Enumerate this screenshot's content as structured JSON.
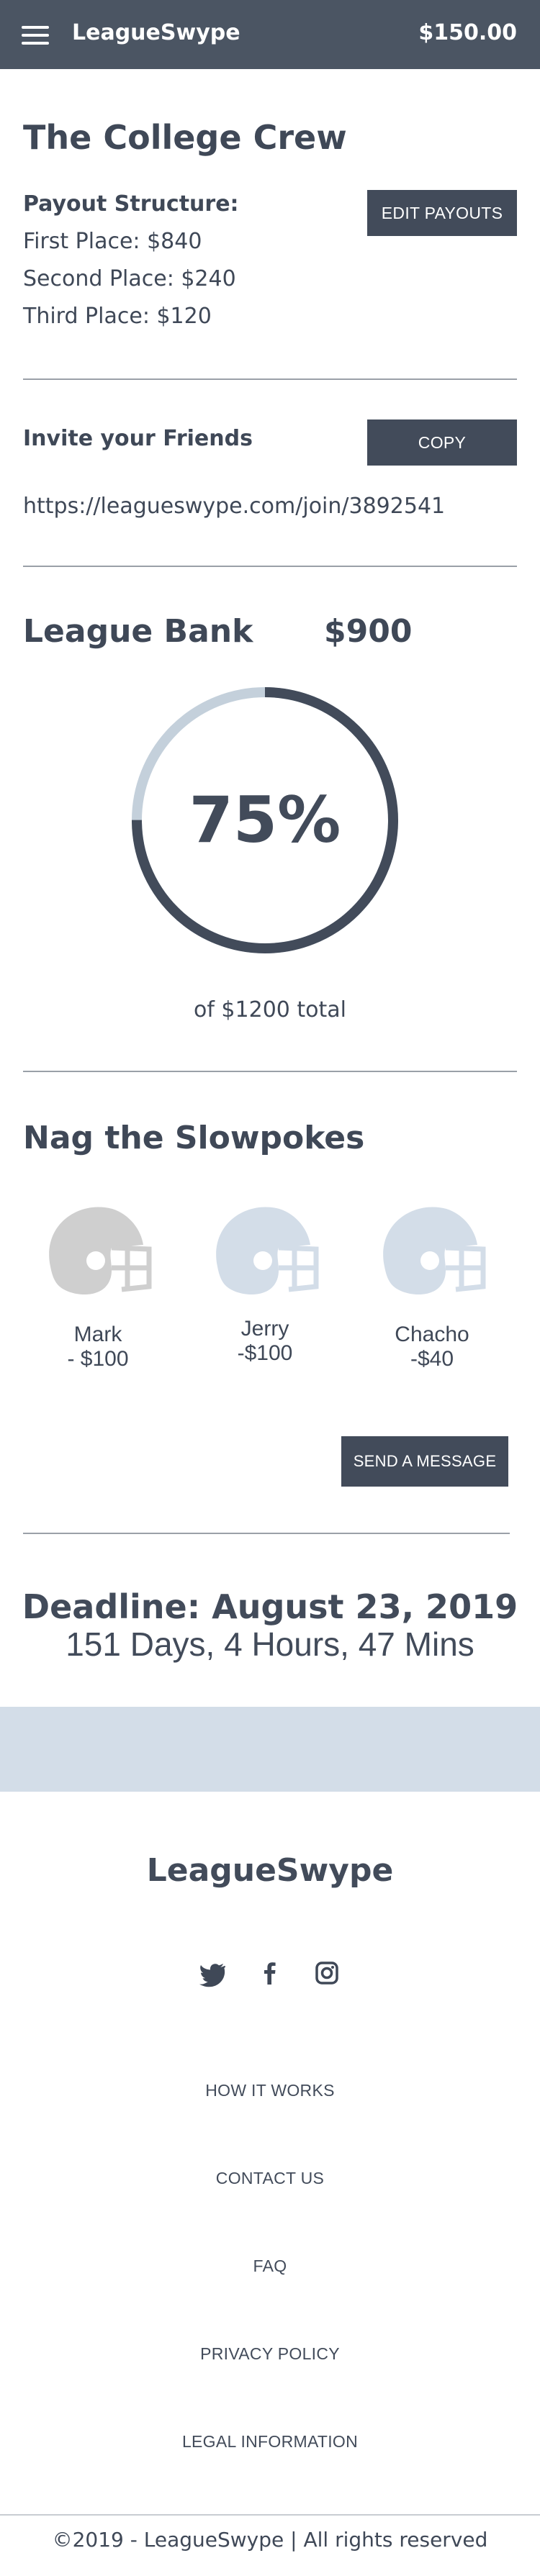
{
  "header": {
    "brand": "LeagueSwype",
    "balance": "$150.00"
  },
  "league": {
    "name": "The College Crew",
    "payout_label": "Payout Structure:",
    "payouts": [
      "First Place: $840",
      "Second Place: $240",
      "Third Place: $120"
    ],
    "edit_payouts_label": "EDIT PAYOUTS"
  },
  "invite": {
    "label": "Invite your Friends",
    "copy_label": "COPY",
    "link": "https://leagueswype.com/join/3892541"
  },
  "bank": {
    "title": "League Bank",
    "amount": "$900",
    "percent_text": "75%",
    "progress_fraction": 0.75,
    "total_text": "of $1200 total"
  },
  "nag": {
    "title": "Nag the Slowpokes",
    "players": [
      {
        "name": "Mark",
        "amount": "- $100",
        "icon": "helmet-icon"
      },
      {
        "name": "Jerry",
        "amount": "-$100",
        "icon": "helmet-icon"
      },
      {
        "name": "Chacho",
        "amount": "-$40",
        "icon": "helmet-icon"
      }
    ],
    "send_message_label": "SEND A  MESSAGE"
  },
  "deadline": {
    "title": "Deadline: August 23, 2019",
    "countdown": "151 Days, 4 Hours, 47 Mins"
  },
  "footer": {
    "brand": "LeagueSwype",
    "social_icons": [
      "twitter-icon",
      "facebook-icon",
      "instagram-icon"
    ],
    "links": [
      "HOW IT WORKS",
      "CONTACT US",
      "FAQ",
      "PRIVACY POLICY",
      "LEGAL INFORMATION"
    ],
    "copyright": "©2019 - LeagueSwype | All rights reserved"
  },
  "colors": {
    "header_bg": "#4b5563",
    "button_bg": "#424b5a",
    "gauge_track": "#c4d0db",
    "helmet_gray": "#cfcfcf",
    "helmet_blue": "#d3dde8",
    "band_bg": "#d3dde8"
  }
}
